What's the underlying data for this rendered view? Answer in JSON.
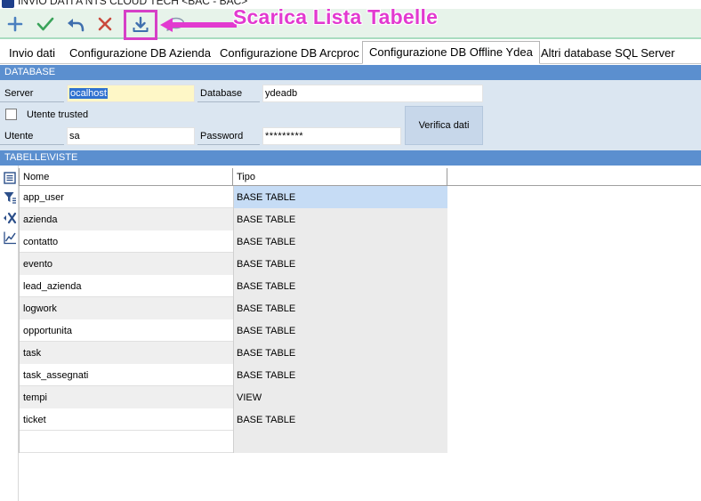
{
  "window": {
    "title": "INVIO DATI A NTS CLOUD TECH <BAC - BAC>"
  },
  "annotation": {
    "text": "Scarica Lista Tabelle",
    "color": "#e23ad0"
  },
  "toolbar": {
    "buttons": [
      {
        "name": "add",
        "icon": "plus-icon"
      },
      {
        "name": "confirm",
        "icon": "check-icon"
      },
      {
        "name": "undo",
        "icon": "undo-icon"
      },
      {
        "name": "cancel",
        "icon": "close-icon"
      },
      {
        "name": "download",
        "icon": "download-icon"
      },
      {
        "name": "chat",
        "icon": "chat-icon"
      }
    ]
  },
  "tabs": [
    {
      "label": "Invio dati"
    },
    {
      "label": "Configurazione DB Azienda"
    },
    {
      "label": "Configurazione DB Arcproc"
    },
    {
      "label": "Configurazione DB Offline Ydea",
      "active": true
    },
    {
      "label": "Altri database SQL Server"
    }
  ],
  "database": {
    "section_title": "DATABASE",
    "server_label": "Server",
    "server_value": "ocalhost",
    "database_label": "Database",
    "database_value": "ydeadb",
    "trusted_label": "Utente trusted",
    "trusted_checked": false,
    "utente_label": "Utente",
    "utente_value": "sa",
    "password_label": "Password",
    "password_value": "*********",
    "verify_label": "Verifica dati"
  },
  "tables": {
    "section_title": "TABELLE\\VISTE",
    "columns": [
      "Nome",
      "Tipo"
    ],
    "rows": [
      {
        "nome": "app_user",
        "tipo": "BASE TABLE"
      },
      {
        "nome": "azienda",
        "tipo": "BASE TABLE"
      },
      {
        "nome": "contatto",
        "tipo": "BASE TABLE"
      },
      {
        "nome": "evento",
        "tipo": "BASE TABLE"
      },
      {
        "nome": "lead_azienda",
        "tipo": "BASE TABLE"
      },
      {
        "nome": "logwork",
        "tipo": "BASE TABLE"
      },
      {
        "nome": "opportunita",
        "tipo": "BASE TABLE"
      },
      {
        "nome": "task",
        "tipo": "BASE TABLE"
      },
      {
        "nome": "task_assegnati",
        "tipo": "BASE TABLE"
      },
      {
        "nome": "tempi",
        "tipo": "VIEW"
      },
      {
        "nome": "ticket",
        "tipo": "BASE TABLE"
      }
    ]
  },
  "side_tools": [
    {
      "icon": "list-icon"
    },
    {
      "icon": "filter-icon"
    },
    {
      "icon": "clear-filter-icon"
    },
    {
      "icon": "chart-icon"
    }
  ],
  "colors": {
    "toolbar_bg": "#e7f3ea",
    "section_header": "#5b8fcf",
    "form_bg": "#dbe6f1",
    "selected_cell": "#c6dcf5",
    "highlight": "#d63fc7"
  }
}
